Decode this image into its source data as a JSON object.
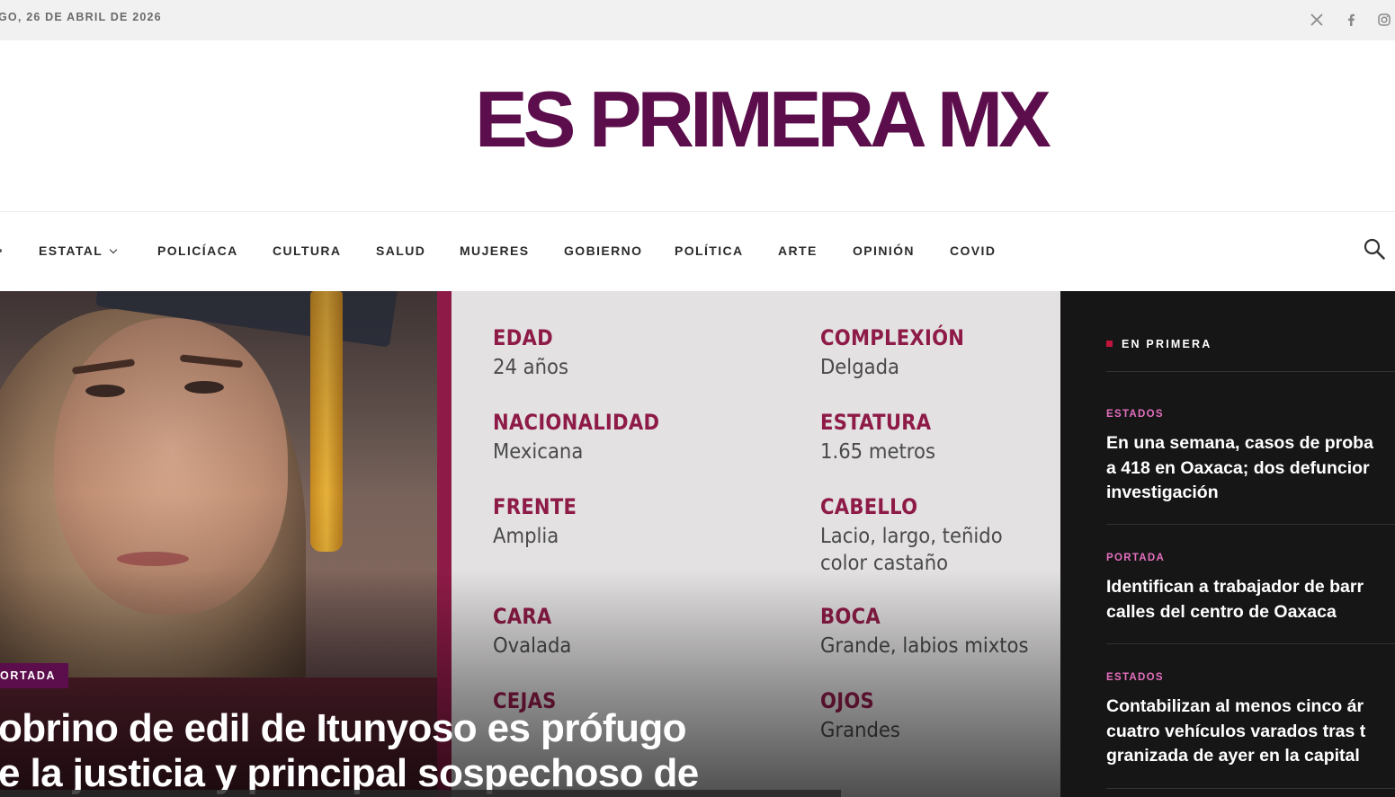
{
  "topbar": {
    "date": "GO, 26 DE ABRIL DE 2026",
    "social": [
      {
        "icon": "x-icon"
      },
      {
        "icon": "facebook-icon"
      },
      {
        "icon": "instagram-icon"
      }
    ]
  },
  "logo": {
    "text": "ES PRIMERA MX",
    "color": "#5c0d4b"
  },
  "nav": {
    "items": [
      "ESTATAL",
      "POLICÍACA",
      "CULTURA",
      "SALUD",
      "MUJERES",
      "GOBIERNO",
      "POLÍTICA",
      "ARTE",
      "OPINIÓN",
      "COVID"
    ]
  },
  "hero": {
    "badge": "ORTADA",
    "headline_lines": [
      "obrino de edil de Itunyoso es prófugo",
      "e la justicia y principal sospechoso de"
    ],
    "card": {
      "left": [
        {
          "label": "EDAD",
          "value": "24 años"
        },
        {
          "label": "NACIONALIDAD",
          "value": "Mexicana"
        },
        {
          "label": "FRENTE",
          "value": "Amplia"
        },
        {
          "label": "CARA",
          "value": "Ovalada"
        },
        {
          "label": "CEJAS",
          "value": ""
        }
      ],
      "right": [
        {
          "label": "COMPLEXIÓN",
          "value": "Delgada"
        },
        {
          "label": "ESTATURA",
          "value": "1.65 metros"
        },
        {
          "label": "CABELLO",
          "value": "Lacio, largo, teñido",
          "value2": "color castaño"
        },
        {
          "label": "BOCA",
          "value": "Grande, labios mixtos"
        },
        {
          "label": "OJOS",
          "value": "Grandes"
        }
      ]
    }
  },
  "sidebar": {
    "title": "EN PRIMERA",
    "accent": "#c0143c",
    "posts": [
      {
        "category": "ESTADOS",
        "lines": [
          "En una semana, casos de proba",
          "a 418 en Oaxaca; dos defuncior",
          "investigación"
        ]
      },
      {
        "category": "PORTADA",
        "lines": [
          "Identifican a trabajador de barr",
          "calles del centro de Oaxaca"
        ]
      },
      {
        "category": "ESTADOS",
        "lines": [
          "Contabilizan al menos cinco ár",
          "cuatro vehículos varados tras t",
          "granizada de ayer en la capital"
        ]
      }
    ]
  }
}
